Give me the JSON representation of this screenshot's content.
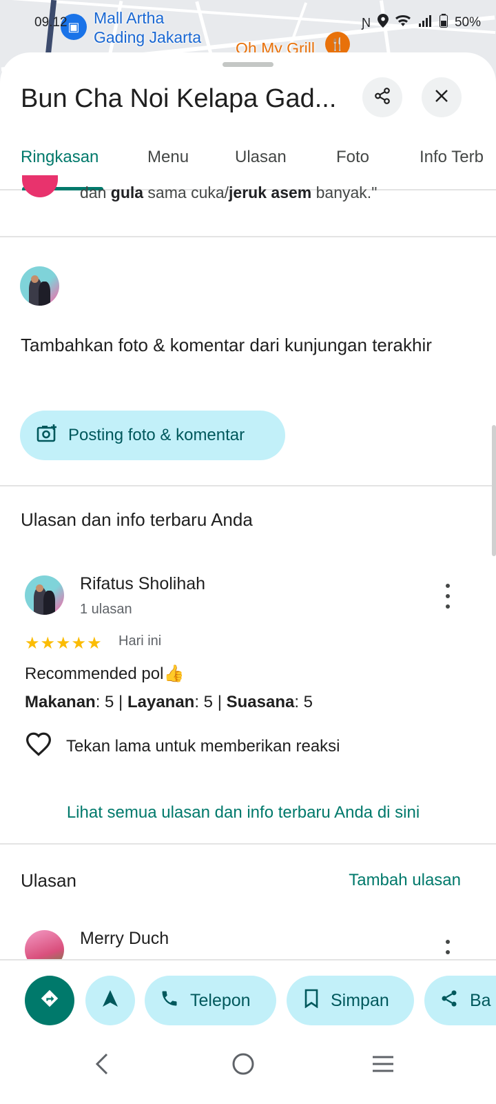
{
  "status_bar": {
    "time": "09.12",
    "battery": "50%"
  },
  "map": {
    "poi1": "Mall Artha\nGading Jakarta",
    "poi1_line1": "Mall Artha",
    "poi1_line2": "Gading Jakarta",
    "poi2": "Oh My Grill"
  },
  "place": {
    "title": "Bun Cha Noi Kelapa Gad..."
  },
  "tabs": [
    {
      "label": "Ringkasan",
      "active": true
    },
    {
      "label": "Menu"
    },
    {
      "label": "Ulasan"
    },
    {
      "label": "Foto"
    },
    {
      "label": "Info Terb"
    }
  ],
  "snippet": {
    "pre": "dan ",
    "b1": "gula",
    "mid": " sama cuka/",
    "b2": "jeruk asem",
    "post": " banyak.\""
  },
  "add_post": {
    "title": "Tambahkan foto & komentar dari kunjungan terakhir",
    "button_label": "Posting foto & komentar"
  },
  "your_reviews": {
    "heading": "Ulasan dan info terbaru Anda",
    "reviewer": "Rifatus Sholihah",
    "reviewer_sub": "1 ulasan",
    "stars": "★★★★★",
    "rating": 5,
    "when": "Hari ini",
    "text": "Recommended pol👍",
    "ratings": {
      "k1": "Makanan",
      "v1": ": 5 | ",
      "k2": "Layanan",
      "v2": ": 5 | ",
      "k3": "Suasana",
      "v3": ": 5"
    },
    "reaction_hint": "Tekan lama untuk memberikan reaksi",
    "see_all": "Lihat semua ulasan dan info terbaru Anda di sini"
  },
  "reviews": {
    "heading": "Ulasan",
    "add_label": "Tambah ulasan",
    "first_reviewer": "Merry Duch"
  },
  "actions": {
    "call": "Telepon",
    "save": "Simpan",
    "share": "Ba"
  },
  "colors": {
    "accent": "#00796b",
    "tonal": "#c2f0f9",
    "star": "#fbbc04"
  }
}
